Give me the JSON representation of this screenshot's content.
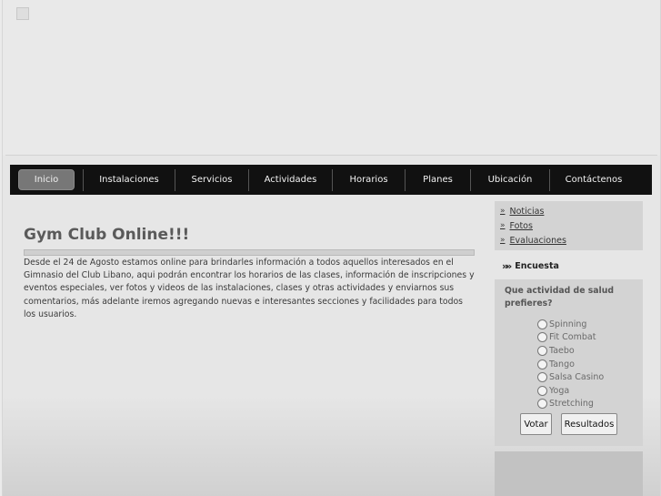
{
  "nav": {
    "items": [
      "Inicio",
      "Instalaciones",
      "Servicios",
      "Actividades",
      "Horarios",
      "Planes",
      "Ubicación",
      "Contáctenos"
    ],
    "active": "Inicio"
  },
  "main": {
    "title": "Gym Club Online!!!",
    "intro": "Desde el 24 de Agosto estamos online para brindarles información a todos aquellos interesados en el Gimnasio del Club Libano, aqui podrán encontrar los horarios de las clases,  información de inscripciones y eventos especiales, ver fotos y videos de las instalaciones, clases y otras actividades y enviarnos sus comentarios, más adelante iremos agregando nuevas e interesantes secciones y facilidades para todos los usuarios."
  },
  "sidebar": {
    "links": [
      "Noticias",
      "Fotos",
      "Evaluaciones"
    ],
    "link_bullet": "»"
  },
  "poll": {
    "heading": "Encuesta",
    "heading_icon": "double-chevron-icon",
    "question": "Que actividad de salud prefieres?",
    "options": [
      "Spinning",
      "Fit Combat",
      "Taebo",
      "Tango",
      "Salsa Casino",
      "Yoga",
      "Stretching"
    ],
    "vote_label": "Votar",
    "results_label": "Resultados"
  },
  "colors": {
    "navbar": "#111111",
    "page_background": "#e9e9e9",
    "sidebar_panel": "#d3d3d3"
  }
}
